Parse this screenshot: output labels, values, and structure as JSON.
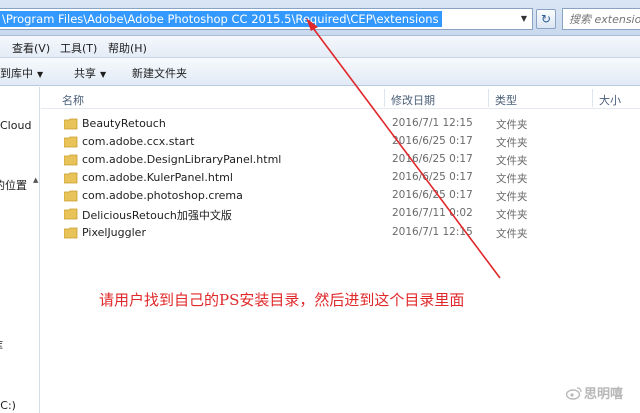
{
  "address_bar": {
    "path": "\\Program Files\\Adobe\\Adobe Photoshop CC 2015.5\\Required\\CEP\\extensions",
    "search_placeholder": "搜索 extensions"
  },
  "menu": [
    "查看(V)",
    "工具(T)",
    "帮助(H)"
  ],
  "toolbar": {
    "include_label": "包含到库中",
    "share_label": "共享",
    "new_folder_label": "新建文件夹"
  },
  "nav_items": [
    "Cloud",
    "的位置",
    "库",
    "(C:)"
  ],
  "columns": {
    "name": "名称",
    "date": "修改日期",
    "type": "类型",
    "size": "大小"
  },
  "files": [
    {
      "name": "BeautyRetouch",
      "date": "2016/7/1 12:15",
      "type": "文件夹"
    },
    {
      "name": "com.adobe.ccx.start",
      "date": "2016/6/25 0:17",
      "type": "文件夹"
    },
    {
      "name": "com.adobe.DesignLibraryPanel.html",
      "date": "2016/6/25 0:17",
      "type": "文件夹"
    },
    {
      "name": "com.adobe.KulerPanel.html",
      "date": "2016/6/25 0:17",
      "type": "文件夹"
    },
    {
      "name": "com.adobe.photoshop.crema",
      "date": "2016/6/25 0:17",
      "type": "文件夹"
    },
    {
      "name": "DeliciousRetouch加强中文版",
      "date": "2016/7/11 0:02",
      "type": "文件夹"
    },
    {
      "name": "PixelJuggler",
      "date": "2016/7/1 12:15",
      "type": "文件夹"
    }
  ],
  "annotation": "请用户找到自己的PS安装目录，然后进到这个目录里面",
  "watermark": "思明嘻",
  "colors": {
    "selection": "#3399ff",
    "annotation_red": "#e0282a",
    "folder_yellow": "#e8c35a"
  }
}
